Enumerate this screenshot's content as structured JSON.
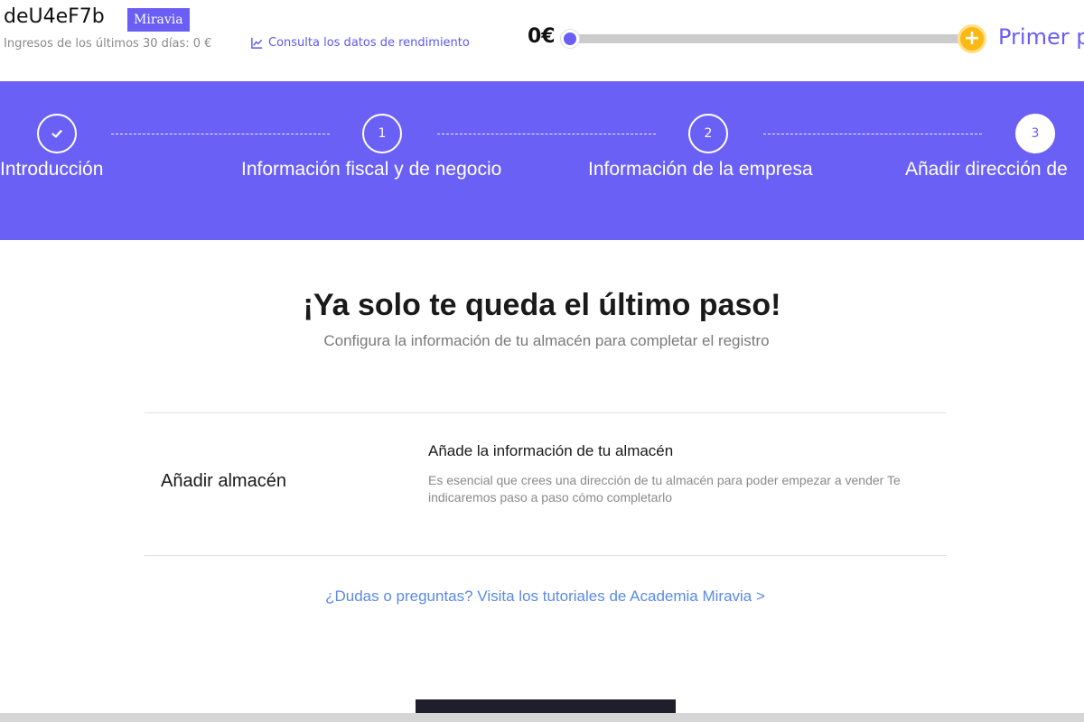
{
  "header": {
    "store_name": "deU4eF7b",
    "brand_badge": "Miravia",
    "earnings_text": "Ingresos de los últimos 30 días: 0 €",
    "performance_link": "Consulta los datos de rendimiento",
    "progress": {
      "current_amount": "0€",
      "goal_label": "Primer p",
      "goal_icon": "plus-coin-icon",
      "fraction": 0
    }
  },
  "stepper": {
    "steps": [
      {
        "marker": "",
        "icon": "check-icon",
        "label": "Introducción",
        "state": "completed"
      },
      {
        "marker": "1",
        "label": "Información fiscal y de negocio",
        "state": "pending"
      },
      {
        "marker": "2",
        "label": "Información de la empresa",
        "state": "pending"
      },
      {
        "marker": "3",
        "label": "Añadir dirección de",
        "state": "active"
      }
    ],
    "background_color": "#6b60f6"
  },
  "main": {
    "title": "¡Ya solo te queda el último paso!",
    "subtitle": "Configura la información de tu almacén para completar el registro",
    "warehouse_section": {
      "label": "Añadir almacén",
      "heading": "Añade la información de tu almacén",
      "description": "Es esencial que crees una dirección de tu almacén para poder empezar a vender Te indicaremos paso a paso cómo completarlo"
    },
    "help_link": "¿Dudas o preguntas? Visita los tutoriales de Academia Miravia >"
  },
  "colors": {
    "accent": "#6a5ef5",
    "link": "#5b8ae6",
    "goal": "#fdb913"
  }
}
